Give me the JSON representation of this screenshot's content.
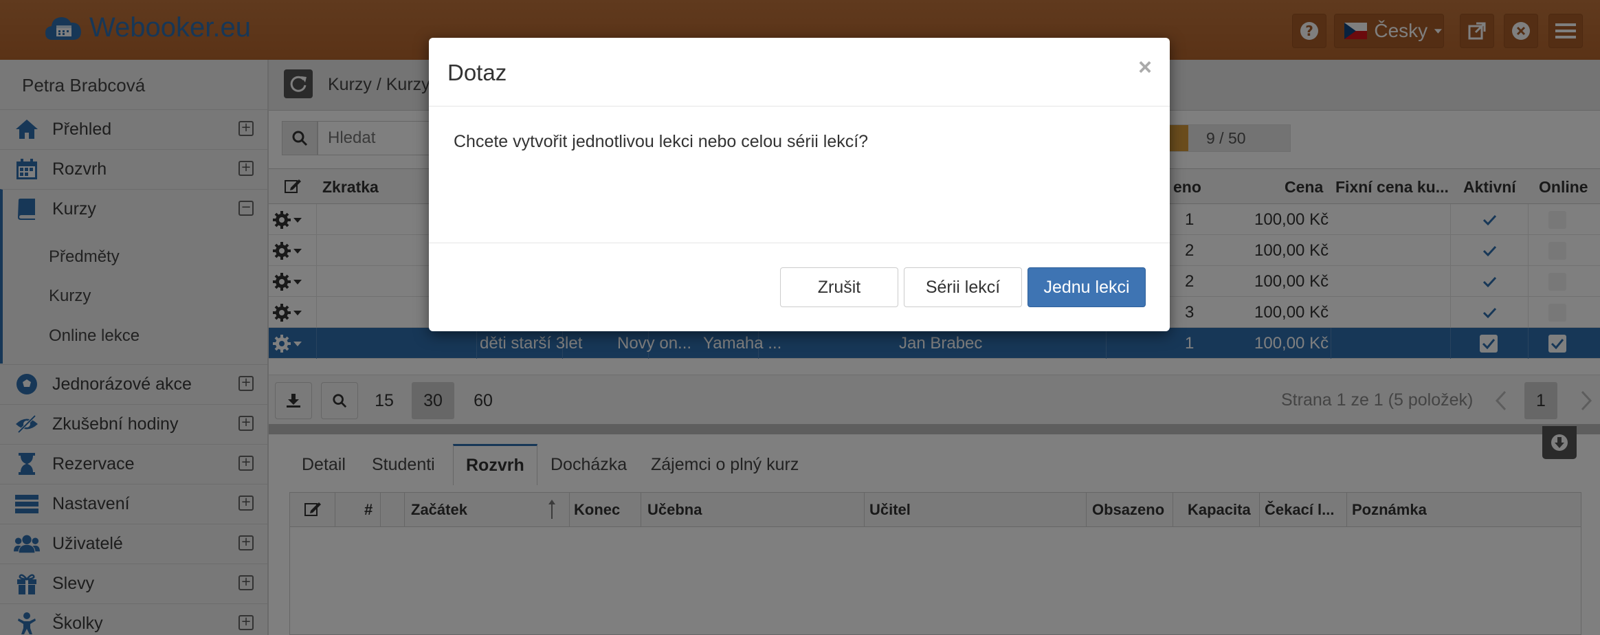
{
  "header": {
    "app_title": "Webooker.eu",
    "language_label": "Česky"
  },
  "sidebar": {
    "user_name": "Petra Brabcová",
    "items": [
      {
        "label": "Přehled",
        "icon": "home-icon"
      },
      {
        "label": "Rozvrh",
        "icon": "calendar-icon"
      },
      {
        "label": "Kurzy",
        "icon": "book-icon"
      },
      {
        "label": "Jednorázové akce",
        "icon": "soccer-ball-icon"
      },
      {
        "label": "Zkušební hodiny",
        "icon": "eye-slash-icon"
      },
      {
        "label": "Rezervace",
        "icon": "hourglass-icon"
      },
      {
        "label": "Nastavení",
        "icon": "server-icon"
      },
      {
        "label": "Uživatelé",
        "icon": "users-icon"
      },
      {
        "label": "Slevy",
        "icon": "gift-icon"
      },
      {
        "label": "Školky",
        "icon": "child-icon"
      }
    ],
    "subitems": [
      "Předměty",
      "Kurzy",
      "Online lekce"
    ]
  },
  "breadcrumb": "Kurzy / Kurzy",
  "search": {
    "placeholder": "Hledat"
  },
  "capacity_text": "9 / 50",
  "grid": {
    "headers": {
      "short": "Zkratka",
      "occupied": "eno",
      "price": "Cena",
      "fixed_price": "Fixní cena ku...",
      "active": "Aktivní",
      "online": "Online"
    },
    "rows": [
      {
        "occupied": "1",
        "price": "100,00 Kč"
      },
      {
        "occupied": "2",
        "price": "100,00 Kč"
      },
      {
        "occupied": "2",
        "price": "100,00 Kč"
      },
      {
        "occupied": "3",
        "price": "100,00 Kč"
      },
      {
        "occupied": "1",
        "price": "100,00 Kč",
        "group": "děti starší 3let",
        "subject": "Novy on...",
        "place": "Yamaha ...",
        "teacher": "Jan Brabec"
      }
    ]
  },
  "pager": {
    "sizes": [
      "15",
      "30",
      "60"
    ],
    "active_size": "30",
    "info": "Strana 1 ze 1 (5 položek)",
    "current_page": "1"
  },
  "tabs": [
    "Detail",
    "Studenti",
    "Rozvrh",
    "Docházka",
    "Zájemci o plný kurz"
  ],
  "active_tab": "Rozvrh",
  "schedule_grid": {
    "headers": [
      "#",
      "Začátek",
      "Konec",
      "Učebna",
      "Učitel",
      "Obsazeno",
      "Kapacita",
      "Čekací l...",
      "Poznámka"
    ]
  },
  "dialog": {
    "title": "Dotaz",
    "close": "×",
    "message": "Chcete vytvořit jednotlivou lekci nebo celou sérii lekcí?",
    "cancel": "Zrušit",
    "series": "Sérii lekcí",
    "single": "Jednu lekci"
  },
  "colors": {
    "accent": "#2f6fae",
    "header": "#b8692f",
    "primary_button": "#3e74b3"
  }
}
